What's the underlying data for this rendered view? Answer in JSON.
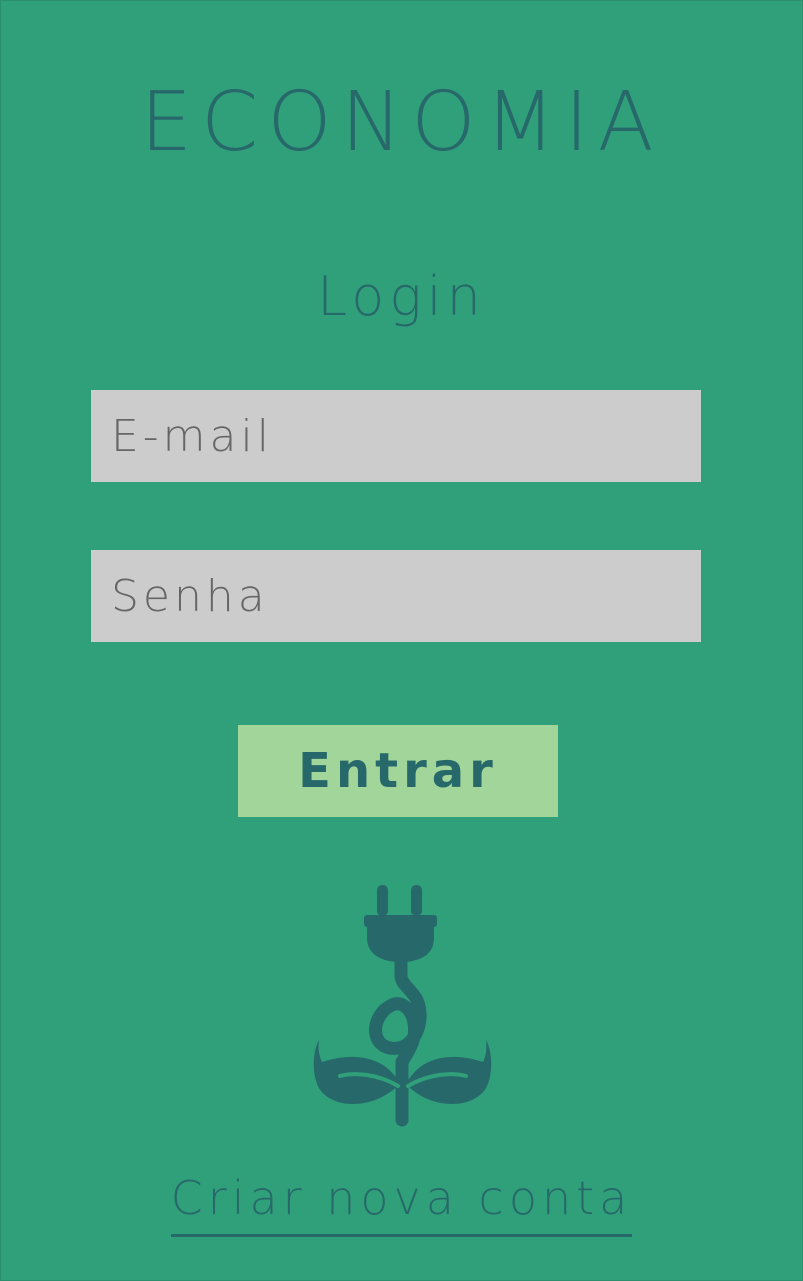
{
  "app": {
    "title": "ECONOMIA"
  },
  "login": {
    "heading": "Login",
    "email_placeholder": "E-mail",
    "email_value": "",
    "password_placeholder": "Senha",
    "password_value": "",
    "submit_label": "Entrar",
    "logo_icon": "plug-plant-icon",
    "create_account_label": "Criar nova conta"
  },
  "colors": {
    "background": "#30a07a",
    "text": "#27696a",
    "input_background": "#cccccc",
    "button_background": "#a1d599"
  }
}
